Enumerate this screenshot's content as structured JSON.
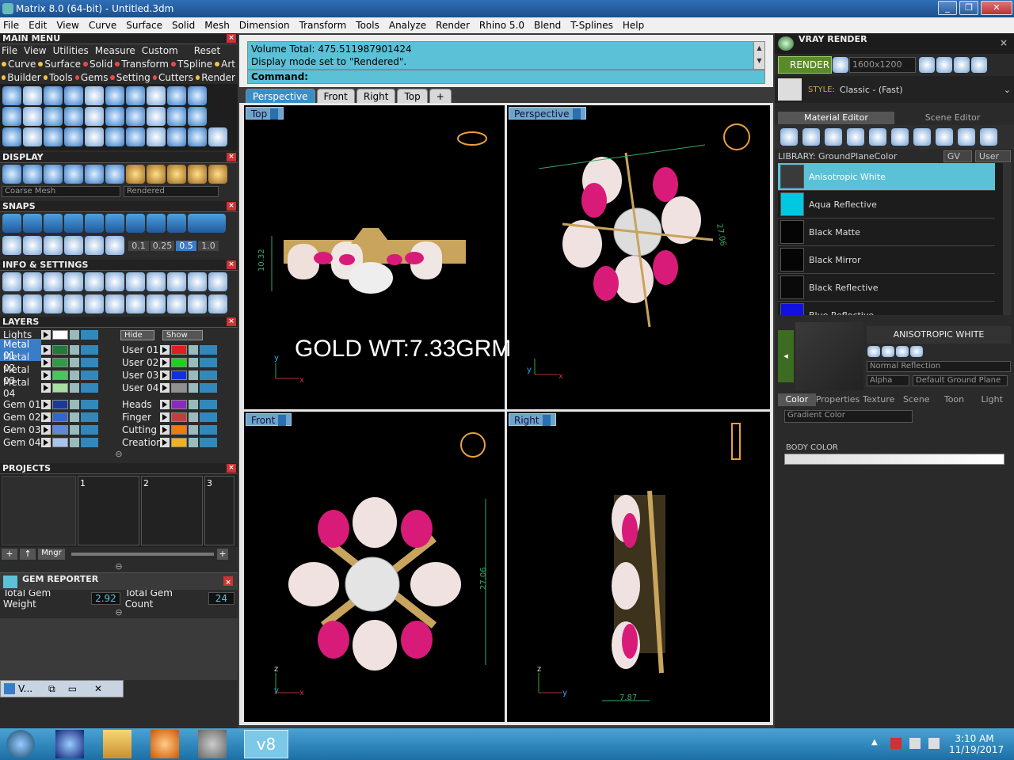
{
  "window": {
    "title": "Matrix 8.0 (64-bit) - Untitled.3dm",
    "min": "_",
    "max": "❐",
    "close": "✕"
  },
  "menubar": [
    "File",
    "Edit",
    "View",
    "Curve",
    "Surface",
    "Solid",
    "Mesh",
    "Dimension",
    "Transform",
    "Tools",
    "Analyze",
    "Render",
    "Rhino 5.0",
    "Blend",
    "T-Splines",
    "Help"
  ],
  "main_menu": {
    "title": "MAIN MENU",
    "row1": [
      "File",
      "View",
      "Utilities",
      "Measure",
      "Custom"
    ],
    "reset": "Reset",
    "row2": [
      "Curve",
      "Surface",
      "Solid",
      "Transform",
      "TSpline",
      "Art"
    ],
    "row3": [
      "Builder",
      "Tools",
      "Gems",
      "Setting",
      "Cutters",
      "Render"
    ]
  },
  "display": {
    "title": "DISPLAY",
    "mesh": "Coarse Mesh",
    "mode": "Rendered"
  },
  "snaps": {
    "title": "SNAPS",
    "values": [
      "0.1",
      "0.25",
      "0.5",
      "1.0"
    ]
  },
  "info": {
    "title": "INFO & SETTINGS"
  },
  "layers": {
    "title": "LAYERS",
    "lights": "Lights",
    "hide": "Hide",
    "show": "Show",
    "left": [
      {
        "name": "Metal 01",
        "color": "#1e7d3c"
      },
      {
        "name": "Metal 02",
        "color": "#2e9a4a"
      },
      {
        "name": "Metal 03",
        "color": "#4cc45a"
      },
      {
        "name": "Metal 04",
        "color": "#a6e0a0"
      },
      {
        "name": "Gem 01",
        "color": "#1a3a9a"
      },
      {
        "name": "Gem 02",
        "color": "#3366cc"
      },
      {
        "name": "Gem 03",
        "color": "#5a8ad8"
      },
      {
        "name": "Gem 04",
        "color": "#a8c4ec"
      }
    ],
    "right": [
      {
        "name": "User 01",
        "color": "#e02020"
      },
      {
        "name": "User 02",
        "color": "#20d020"
      },
      {
        "name": "User 03",
        "color": "#1030e0"
      },
      {
        "name": "User 04",
        "color": "#909090"
      },
      {
        "name": "Heads",
        "color": "#8a2ac0"
      },
      {
        "name": "Finger",
        "color": "#c04040"
      },
      {
        "name": "Cutting",
        "color": "#f07a10"
      },
      {
        "name": "Creation",
        "color": "#f0b020"
      }
    ]
  },
  "projects": {
    "title": "PROJECTS",
    "slots": [
      "1",
      "2",
      "3"
    ],
    "mngr": "Mngr"
  },
  "gem_reporter": {
    "title": "GEM REPORTER",
    "weight_label": "Total Gem Weight",
    "weight": "2.92",
    "count_label": "Total Gem Count",
    "count": "24"
  },
  "minimized": {
    "label": "V..."
  },
  "command": {
    "line1": "Volume Total: 475.511987901424",
    "line2": "Display mode set to \"Rendered\".",
    "prompt": "Command:"
  },
  "view_tabs": [
    "Perspective",
    "Front",
    "Right",
    "Top",
    "+"
  ],
  "viewports": {
    "tl": "Top",
    "tr": "Perspective",
    "bl": "Front",
    "br": "Right"
  },
  "dims": {
    "top": "10.32",
    "persp": "27.06",
    "front": "27.06",
    "right": "7.87"
  },
  "overlay": "GOLD WT:7.33GRM",
  "vray": {
    "title": "VRAY RENDER",
    "render": "RENDER",
    "size": "1600x1200",
    "style_label": "STYLE:",
    "style": "Classic - (Fast)",
    "tabs": [
      "Material Editor",
      "Scene Editor"
    ],
    "library": "LIBRARY: GroundPlaneColor",
    "gv": "GV",
    "user": "User",
    "materials": [
      {
        "name": "Anisotropic White",
        "color": "#3a3a3a"
      },
      {
        "name": "Aqua Reflective",
        "color": "#00c8e0"
      },
      {
        "name": "Black Matte",
        "color": "#050505"
      },
      {
        "name": "Black Mirror",
        "color": "#050505"
      },
      {
        "name": "Black Reflective",
        "color": "#0a0a0a"
      },
      {
        "name": "Blue Reflective",
        "color": "#1010e0"
      }
    ],
    "selected": "ANISOTROPIC WHITE",
    "reflection": "Normal Reflection",
    "alpha": "Alpha",
    "ground": "Default Ground Plane",
    "prop_tabs": [
      "Color",
      "Properties",
      "Texture",
      "Scene",
      "Toon",
      "Light"
    ],
    "gradient": "Gradient Color",
    "body_color": "BODY COLOR"
  },
  "clock": {
    "time": "3:10 AM",
    "date": "11/19/2017"
  },
  "taskbar": {
    "active": "v8"
  }
}
